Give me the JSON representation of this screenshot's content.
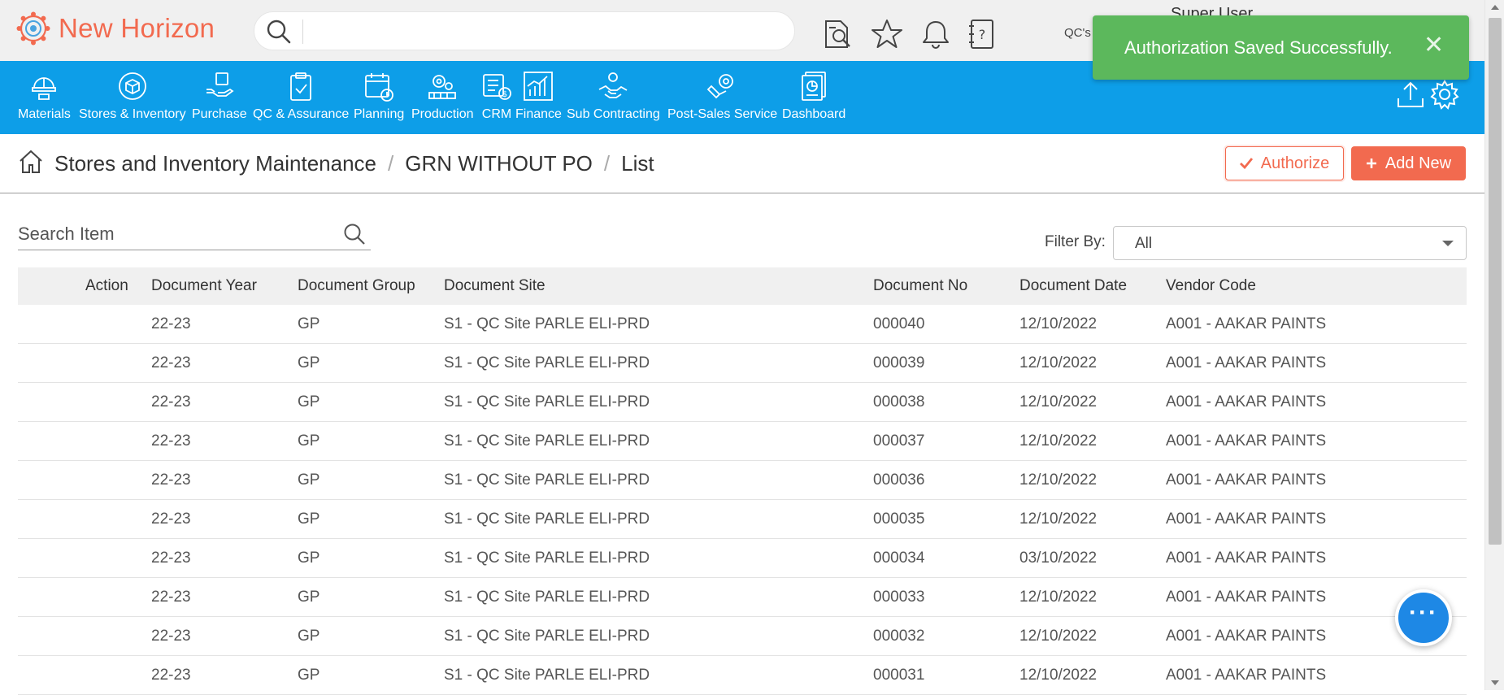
{
  "app": {
    "name": "New Horizon",
    "user": "Super User",
    "user_sub": "QC's"
  },
  "colors": {
    "brand": "#f26a4f",
    "nav": "#0d9ee8",
    "toast": "#5cb85c"
  },
  "toast": {
    "message": "Authorization Saved Successfully.",
    "close": "✕"
  },
  "modules": [
    {
      "label": "Materials",
      "icon": "materials-icon"
    },
    {
      "label": "Stores & Inventory",
      "icon": "stores-inventory-icon"
    },
    {
      "label": "Purchase",
      "icon": "purchase-icon"
    },
    {
      "label": "QC & Assurance",
      "icon": "qc-assurance-icon"
    },
    {
      "label": "Planning",
      "icon": "planning-icon"
    },
    {
      "label": "Production",
      "icon": "production-icon"
    },
    {
      "label": "CRM",
      "icon": "crm-icon"
    },
    {
      "label": "Finance",
      "icon": "finance-icon"
    },
    {
      "label": "Sub Contracting",
      "icon": "sub-contracting-icon"
    },
    {
      "label": "Post-Sales Service",
      "icon": "post-sales-service-icon"
    },
    {
      "label": "Dashboard",
      "icon": "dashboard-icon"
    }
  ],
  "breadcrumb": {
    "level1": "Stores and Inventory Maintenance",
    "level2": "GRN WITHOUT PO",
    "level3": "List",
    "sep": "/"
  },
  "actions": {
    "authorize": "Authorize",
    "add_new": "Add New"
  },
  "search": {
    "placeholder": "Search Item"
  },
  "filter": {
    "label": "Filter By:",
    "value": "All"
  },
  "table": {
    "headers": {
      "action": "Action",
      "year": "Document Year",
      "group": "Document Group",
      "site": "Document Site",
      "no": "Document No",
      "date": "Document Date",
      "vendor": "Vendor Code"
    },
    "rows": [
      {
        "year": "22-23",
        "group": "GP",
        "site": "S1 - QC Site PARLE ELI-PRD",
        "no": "000040",
        "date": "12/10/2022",
        "vendor": "A001 - AAKAR PAINTS"
      },
      {
        "year": "22-23",
        "group": "GP",
        "site": "S1 - QC Site PARLE ELI-PRD",
        "no": "000039",
        "date": "12/10/2022",
        "vendor": "A001 - AAKAR PAINTS"
      },
      {
        "year": "22-23",
        "group": "GP",
        "site": "S1 - QC Site PARLE ELI-PRD",
        "no": "000038",
        "date": "12/10/2022",
        "vendor": "A001 - AAKAR PAINTS"
      },
      {
        "year": "22-23",
        "group": "GP",
        "site": "S1 - QC Site PARLE ELI-PRD",
        "no": "000037",
        "date": "12/10/2022",
        "vendor": "A001 - AAKAR PAINTS"
      },
      {
        "year": "22-23",
        "group": "GP",
        "site": "S1 - QC Site PARLE ELI-PRD",
        "no": "000036",
        "date": "12/10/2022",
        "vendor": "A001 - AAKAR PAINTS"
      },
      {
        "year": "22-23",
        "group": "GP",
        "site": "S1 - QC Site PARLE ELI-PRD",
        "no": "000035",
        "date": "12/10/2022",
        "vendor": "A001 - AAKAR PAINTS"
      },
      {
        "year": "22-23",
        "group": "GP",
        "site": "S1 - QC Site PARLE ELI-PRD",
        "no": "000034",
        "date": "03/10/2022",
        "vendor": "A001 - AAKAR PAINTS"
      },
      {
        "year": "22-23",
        "group": "GP",
        "site": "S1 - QC Site PARLE ELI-PRD",
        "no": "000033",
        "date": "12/10/2022",
        "vendor": "A001 - AAKAR PAINTS"
      },
      {
        "year": "22-23",
        "group": "GP",
        "site": "S1 - QC Site PARLE ELI-PRD",
        "no": "000032",
        "date": "12/10/2022",
        "vendor": "A001 - AAKAR PAINTS"
      },
      {
        "year": "22-23",
        "group": "GP",
        "site": "S1 - QC Site PARLE ELI-PRD",
        "no": "000031",
        "date": "12/10/2022",
        "vendor": "A001 - AAKAR PAINTS"
      }
    ]
  },
  "chat": {
    "label": "···"
  }
}
